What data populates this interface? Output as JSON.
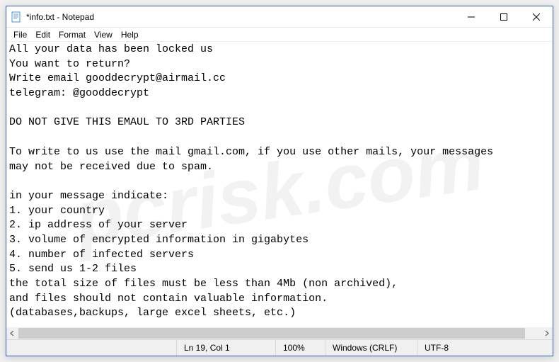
{
  "window": {
    "title": "*info.txt - Notepad"
  },
  "menu": {
    "file": "File",
    "edit": "Edit",
    "format": "Format",
    "view": "View",
    "help": "Help"
  },
  "content": "All your data has been locked us\nYou want to return?\nWrite email gooddecrypt@airmail.cc\ntelegram: @gooddecrypt\n\nDO NOT GIVE THIS EMAUL TO 3RD PARTIES\n\nTo write to us use the mail gmail.com, if you use other mails, your messages\nmay not be received due to spam.\n\nin your message indicate:\n1. your country\n2. ip address of your server\n3. volume of encrypted information in gigabytes\n4. number of infected servers\n5. send us 1-2 files\nthe total size of files must be less than 4Mb (non archived),\nand files should not contain valuable information.\n(databases,backups, large excel sheets, etc.)",
  "status": {
    "lncol": "Ln 19, Col 1",
    "zoom": "100%",
    "eol": "Windows (CRLF)",
    "encoding": "UTF-8"
  },
  "watermark": "pcrisk.com"
}
